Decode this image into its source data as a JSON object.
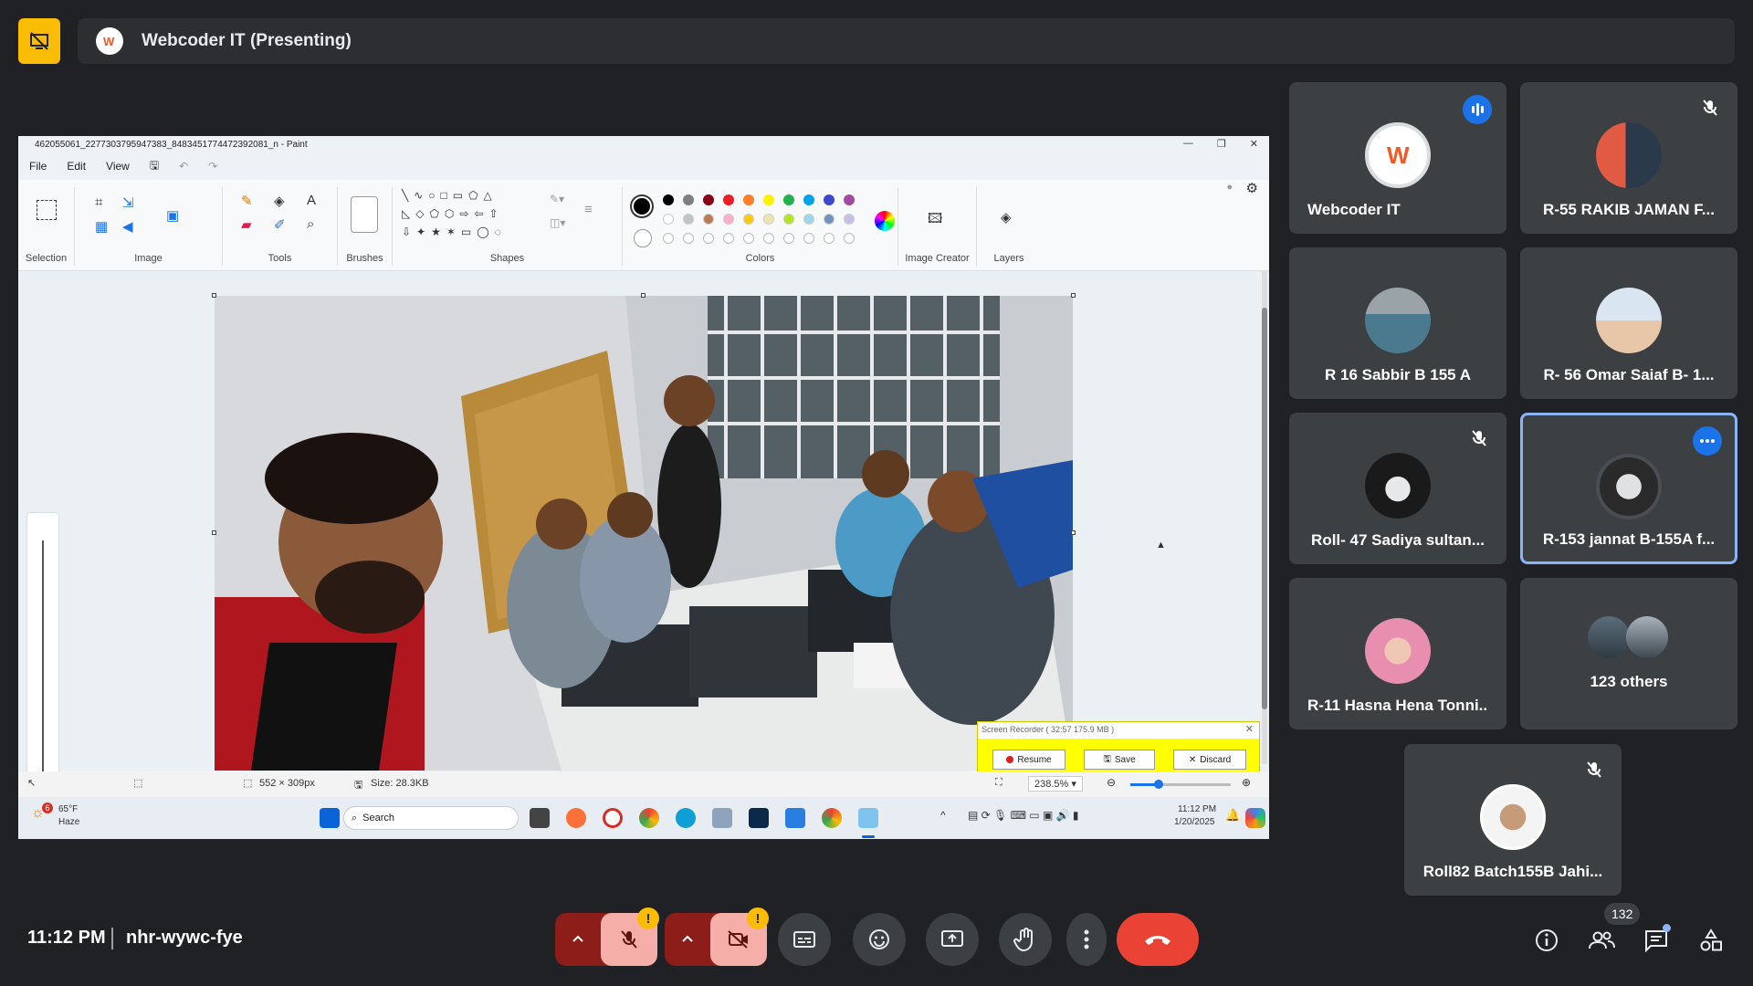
{
  "presentation": {
    "title": "Webcoder IT (Presenting)",
    "icon": "presenting-off-icon"
  },
  "paint": {
    "window_title": "462055061_2277303795947383_8483451774472392081_n - Paint",
    "menu": [
      "File",
      "Edit",
      "View"
    ],
    "groups": [
      "Selection",
      "Image",
      "Tools",
      "Brushes",
      "Shapes",
      "Colors",
      "Image Creator",
      "Layers"
    ],
    "colors_row1": [
      "#000000",
      "#7f7f7f",
      "#880015",
      "#ed1c24",
      "#ff7f27",
      "#fff200",
      "#22b14c",
      "#00a2e8",
      "#3f48cc",
      "#a349a4"
    ],
    "colors_row2": [
      "#ffffff",
      "#c3c3c3",
      "#b97a57",
      "#ffaec9",
      "#ffc90e",
      "#efe4b0",
      "#b5e61d",
      "#99d9ea",
      "#7092be",
      "#c8bfe7"
    ],
    "status_dimensions": "552 × 309px",
    "status_size": "Size: 28.3KB",
    "zoom": "238.5%",
    "recorder": {
      "header": "Screen Recorder ( 32:57   175.9 MB )",
      "resume": "Resume",
      "save": "Save",
      "discard": "Discard"
    },
    "taskbar": {
      "weather_temp": "65°F",
      "weather_desc": "Haze",
      "weather_badge": "6",
      "search": "Search",
      "time": "11:12 PM",
      "date": "1/20/2025"
    }
  },
  "participants": [
    {
      "name": "Webcoder IT",
      "status": "speaking"
    },
    {
      "name": "R-55 RAKIB JAMAN F...",
      "status": "muted"
    },
    {
      "name": "R 16 Sabbir B 155 A",
      "status": ""
    },
    {
      "name": "R- 56 Omar Saiaf B- 1...",
      "status": ""
    },
    {
      "name": "Roll- 47 Sadiya sultan...",
      "status": "muted"
    },
    {
      "name": "R-153 jannat B-155A f...",
      "status": "active"
    },
    {
      "name": "R-11 Hasna Hena Tonni...",
      "status": ""
    },
    {
      "name": "123 others",
      "status": ""
    },
    {
      "name": "Roll82 Batch155B Jahi...",
      "status": "muted"
    }
  ],
  "meeting": {
    "time": "11:12 PM",
    "code": "nhr-wywc-fye",
    "people_count": "132",
    "warning": "!"
  }
}
